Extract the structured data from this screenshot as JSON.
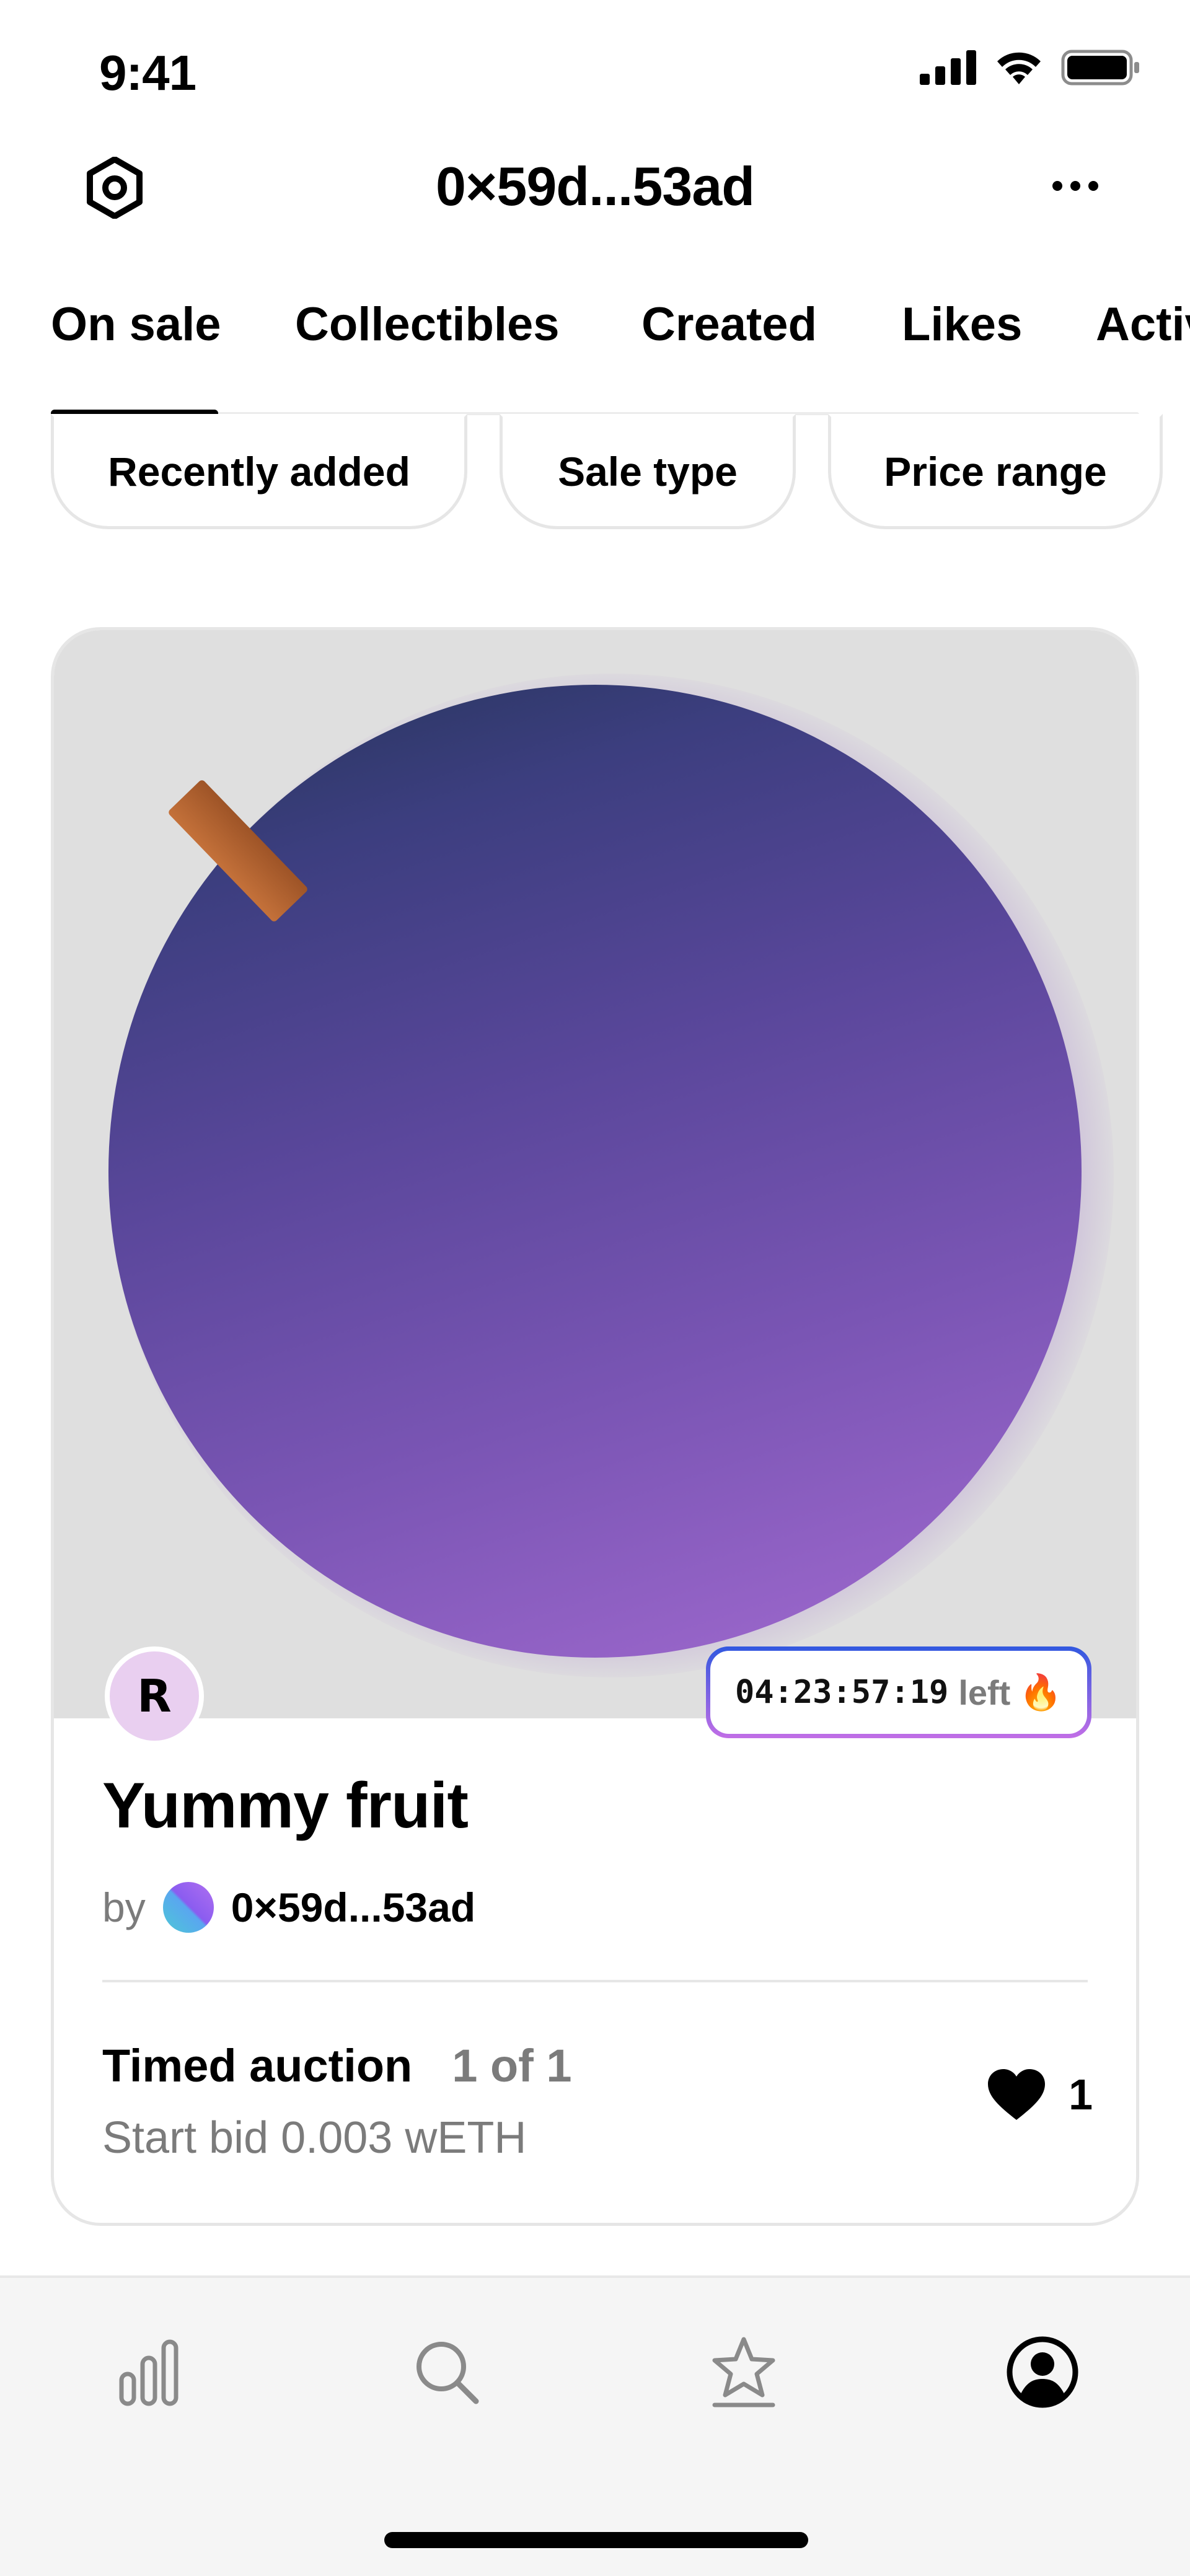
{
  "status_bar": {
    "time": "9:41"
  },
  "header": {
    "title": "0×59d...53ad"
  },
  "tabs": [
    {
      "label": "On sale",
      "active": true
    },
    {
      "label": "Collectibles"
    },
    {
      "label": "Created"
    },
    {
      "label": "Likes"
    },
    {
      "label": "Activity"
    }
  ],
  "filters": [
    {
      "label": "Recently added"
    },
    {
      "label": "Sale type"
    },
    {
      "label": "Price range"
    }
  ],
  "card": {
    "avatar_letter": "R",
    "countdown_time": "04:23:57:19",
    "countdown_suffix": "left",
    "countdown_emoji": "🔥",
    "title": "Yummy fruit",
    "by_label": "by",
    "creator": "0×59d...53ad",
    "sale_type": "Timed auction",
    "edition": "1 of 1",
    "start_bid": "Start bid 0.003 wETH",
    "likes": "1"
  },
  "bottom_nav": [
    {
      "icon": "stats-icon"
    },
    {
      "icon": "search-icon"
    },
    {
      "icon": "star-icon"
    },
    {
      "icon": "profile-icon",
      "active": true
    }
  ],
  "colors": {
    "accent": "#000000",
    "muted_text": "#7b7b7b",
    "countdown_border_start": "#3158e0",
    "countdown_border_end": "#c16ee6"
  }
}
